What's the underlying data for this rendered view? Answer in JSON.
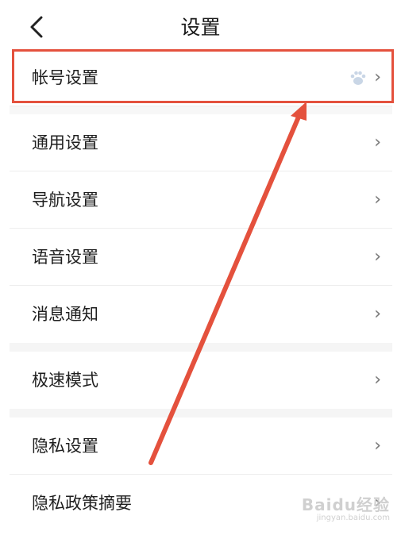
{
  "header": {
    "title": "设置"
  },
  "menu": [
    {
      "label": "帐号设置"
    },
    {
      "label": "通用设置"
    },
    {
      "label": "导航设置"
    },
    {
      "label": "语音设置"
    },
    {
      "label": "消息通知"
    },
    {
      "label": "极速模式"
    },
    {
      "label": "隐私设置"
    },
    {
      "label": "隐私政策摘要"
    }
  ],
  "chevron": "›",
  "watermark": {
    "main": "Baidu经验",
    "sub": "jingyan.baidu.com"
  },
  "colors": {
    "highlight": "#e4513d",
    "arrow": "#e4513d"
  }
}
